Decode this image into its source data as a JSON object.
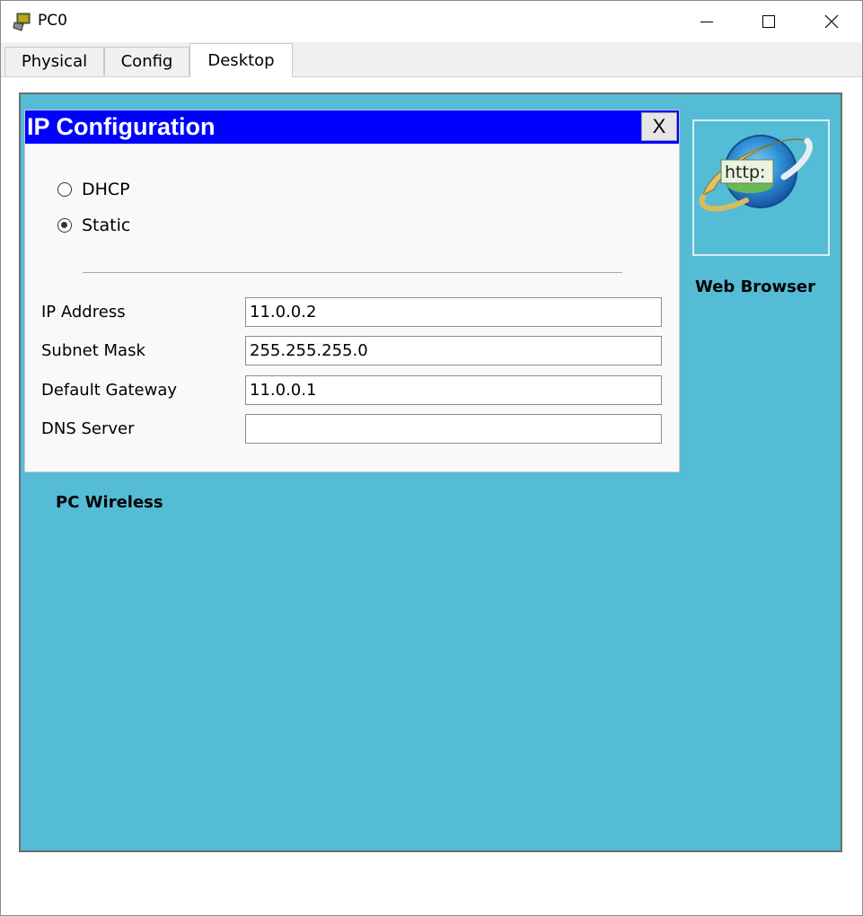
{
  "window": {
    "title": "PC0",
    "controls": {
      "minimize": "minimize-icon",
      "maximize": "maximize-icon",
      "close": "close-icon"
    }
  },
  "tabs": [
    {
      "label": "Physical",
      "active": false
    },
    {
      "label": "Config",
      "active": false
    },
    {
      "label": "Desktop",
      "active": true
    }
  ],
  "ip_config": {
    "title": "IP Configuration",
    "close_label": "X",
    "mode_options": [
      {
        "label": "DHCP",
        "selected": false
      },
      {
        "label": "Static",
        "selected": true
      }
    ],
    "fields": [
      {
        "label": "IP Address",
        "value": "11.0.0.2"
      },
      {
        "label": "Subnet Mask",
        "value": "255.255.255.0"
      },
      {
        "label": "Default Gateway",
        "value": "11.0.0.1"
      },
      {
        "label": "DNS Server",
        "value": ""
      }
    ]
  },
  "desktop_apps": [
    {
      "label": "PC Wireless"
    },
    {
      "label": "Web Browser",
      "icon": "web-browser-icon",
      "icon_text": "http:"
    }
  ],
  "colors": {
    "desktop_bg": "#55bcd5",
    "dialog_title_bg": "#0000ff",
    "dialog_title_text": "#ffffff"
  }
}
